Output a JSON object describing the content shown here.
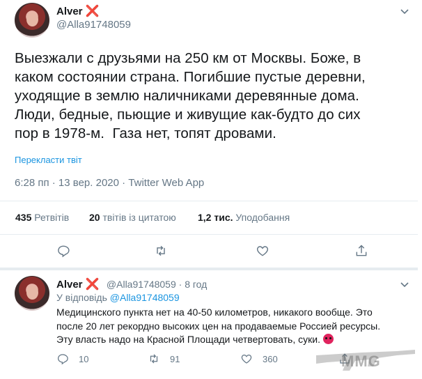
{
  "tweet": {
    "author_name": "Alver",
    "name_mark": "❌",
    "handle": "@Alla91748059",
    "text_lines": [
      "Выезжали с друзьями на 250 км от Москвы. Боже, в",
      "каком состоянии страна. Погибшие пустые деревни,",
      "уходящие в землю наличниками деревянные дома.",
      "Люди, бедные, пьющие и живущие как-будто до сих",
      "пор в 1978-м.  Газа нет, топят дровами."
    ],
    "translate_link": "Перекласти твіт",
    "timestamp": "6:28 пп · 13 вер. 2020 · Twitter Web App",
    "stats": {
      "retweets_count": "435",
      "retweets_label": "Ретвітів",
      "quotes_count": "20",
      "quotes_label": "твітів із цитатою",
      "likes_count": "1,2 тис.",
      "likes_label": "Уподобання"
    },
    "actions": [
      "reply-icon",
      "retweet-icon",
      "like-icon",
      "share-icon"
    ]
  },
  "reply": {
    "author_name": "Alver",
    "name_mark": "❌",
    "handle_time": "@Alla91748059 · 8 год",
    "replying_prefix": "У відповідь",
    "replying_handle": "@Alla91748059",
    "text_lines": [
      "Медицинского пункта нет на 40-50 километров, никакого вообще. Это",
      "после 20 лет рекордно высоких цен на продаваемые Россией ресурсы.",
      "Эту власть надо на Красной Площади четвертовать, суки."
    ],
    "emoji": "angry-face",
    "reply_count": "10",
    "retweet_count": "91",
    "like_count": "360"
  },
  "watermark": "MMG",
  "colors": {
    "link": "#1b95e0",
    "secondary": "#657786",
    "divider": "#e6ecf0",
    "x_mark": "#d6112f"
  }
}
